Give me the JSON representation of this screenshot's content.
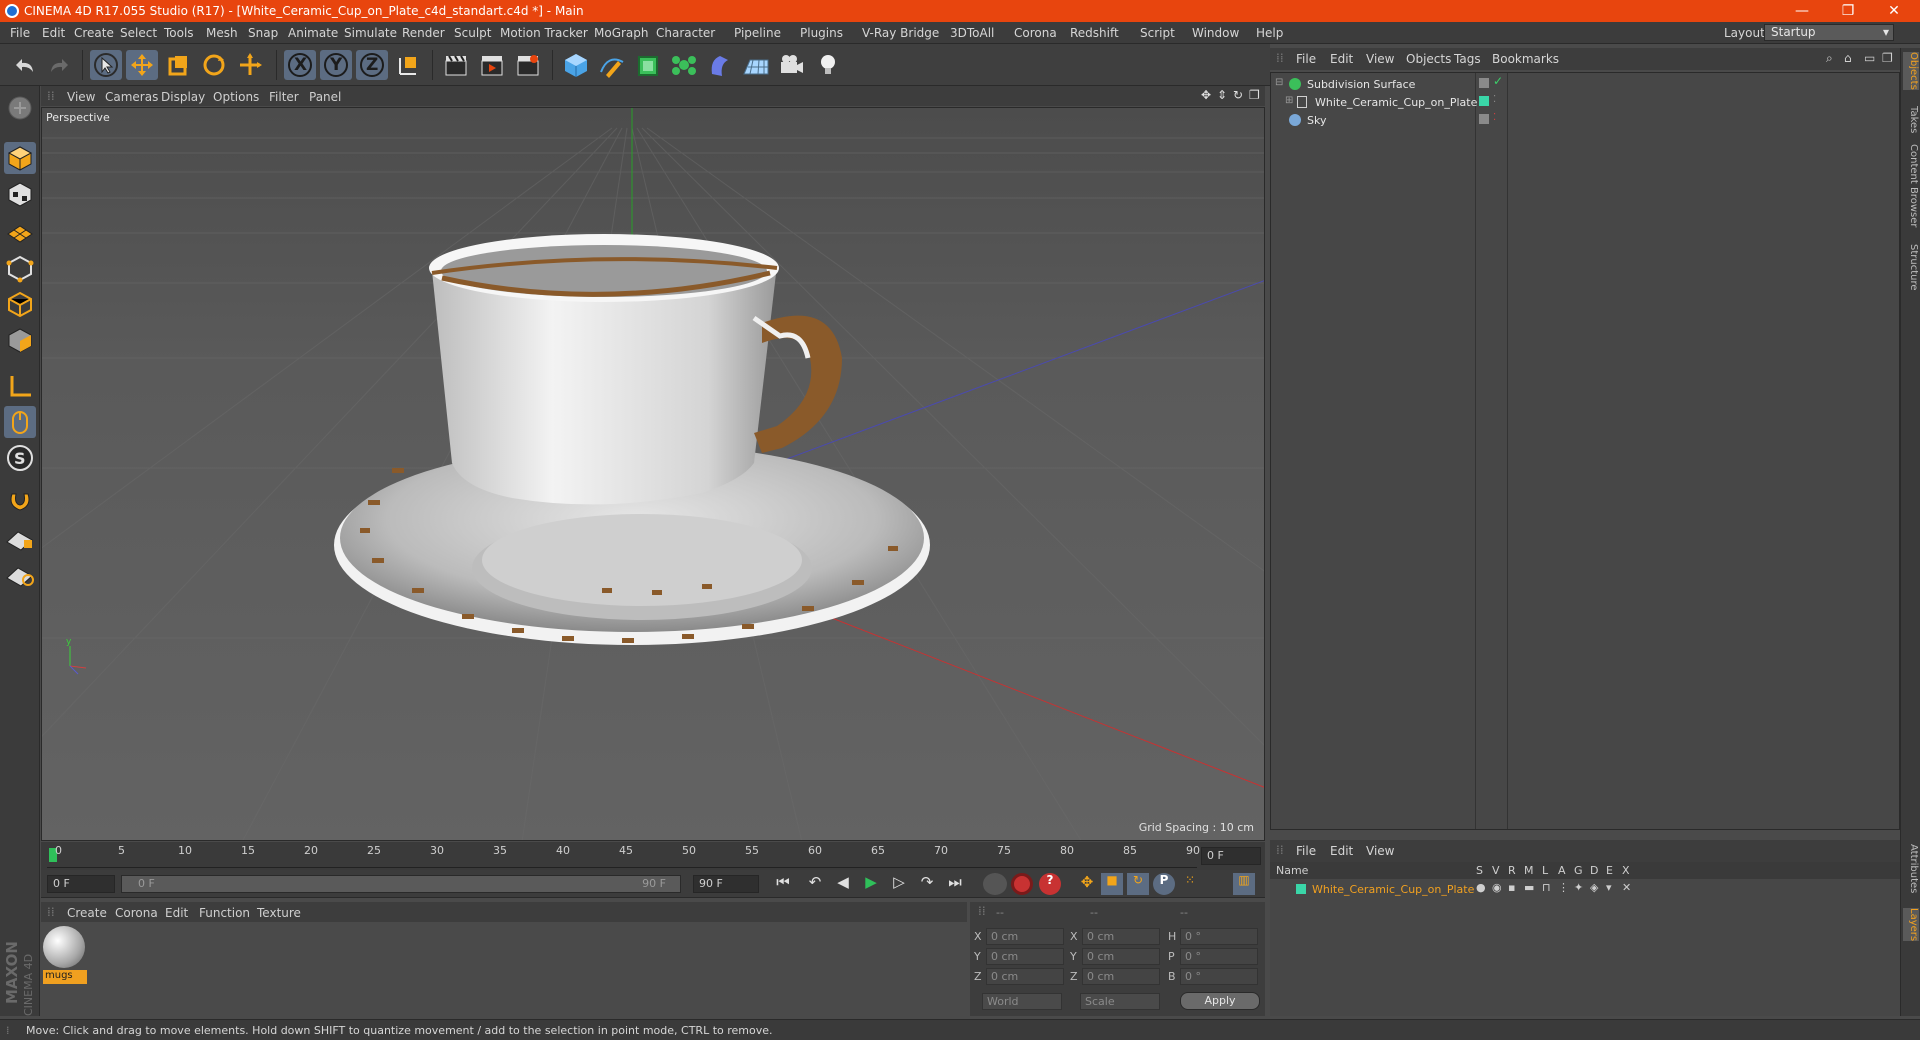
{
  "window": {
    "title": "CINEMA 4D R17.055 Studio (R17) - [White_Ceramic_Cup_on_Plate_c4d_standart.c4d *] - Main",
    "controls": [
      "—",
      "❐",
      "✕"
    ]
  },
  "menubar": {
    "items": [
      "File",
      "Edit",
      "Create",
      "Select",
      "Tools",
      "Mesh",
      "Snap",
      "Animate",
      "Simulate",
      "Render",
      "Sculpt",
      "Motion Tracker",
      "MoGraph",
      "Character",
      "Pipeline",
      "Plugins",
      "V-Ray Bridge",
      "3DToAll",
      "Corona",
      "Redshift",
      "Script",
      "Window",
      "Help"
    ],
    "layout_label": "Layout:",
    "layout_value": "Startup"
  },
  "toolbar": {
    "axis_labels": [
      "X",
      "Y",
      "Z"
    ]
  },
  "viewport": {
    "menu": [
      "View",
      "Cameras",
      "Display",
      "Options",
      "Filter",
      "Panel"
    ],
    "label": "Perspective",
    "grid_spacing": "Grid Spacing : 10 cm"
  },
  "timeline": {
    "ticks": [
      "0",
      "5",
      "10",
      "15",
      "20",
      "25",
      "30",
      "35",
      "40",
      "45",
      "50",
      "55",
      "60",
      "65",
      "70",
      "75",
      "80",
      "85",
      "90"
    ],
    "current_frame": "0 F",
    "start_field": "0 F",
    "range_start": "0 F",
    "range_end": "90 F",
    "end_field": "90 F"
  },
  "materials": {
    "menu": [
      "Create",
      "Corona",
      "Edit",
      "Function",
      "Texture"
    ],
    "items": [
      {
        "name": "mugs"
      }
    ]
  },
  "coordinates": {
    "headers": [
      "--",
      "--",
      "--"
    ],
    "rows": [
      {
        "a": "X",
        "av": "0 cm",
        "b": "X",
        "bv": "0 cm",
        "c": "H",
        "cv": "0 °"
      },
      {
        "a": "Y",
        "av": "0 cm",
        "b": "Y",
        "bv": "0 cm",
        "c": "P",
        "cv": "0 °"
      },
      {
        "a": "Z",
        "av": "0 cm",
        "b": "Z",
        "bv": "0 cm",
        "c": "B",
        "cv": "0 °"
      }
    ],
    "mode_world": "World",
    "mode_scale": "Scale",
    "apply": "Apply"
  },
  "objects": {
    "menu": [
      "File",
      "Edit",
      "View",
      "Objects",
      "Tags",
      "Bookmarks"
    ],
    "rows": [
      {
        "name": "Subdivision Surface"
      },
      {
        "name": "White_Ceramic_Cup_on_Plate"
      },
      {
        "name": "Sky"
      }
    ]
  },
  "layers": {
    "menu": [
      "File",
      "Edit",
      "View"
    ],
    "col_name": "Name",
    "cols": [
      "S",
      "V",
      "R",
      "M",
      "L",
      "A",
      "G",
      "D",
      "E",
      "X"
    ],
    "rows": [
      {
        "name": "White_Ceramic_Cup_on_Plate",
        "color": "#3ad6a8"
      }
    ]
  },
  "sidetabs": [
    "Objects",
    "Takes",
    "Content Browser",
    "Structure",
    "Attributes",
    "Layers"
  ],
  "status": {
    "text": "Move: Click and drag to move elements. Hold down SHIFT to quantize movement / add to the selection in point mode, CTRL to remove."
  },
  "brand": {
    "line1": "MAXON",
    "line2": "CINEMA 4D"
  },
  "colors": {
    "accent": "#e8450e",
    "active_tool": "#5c6c82",
    "selected_text": "#f0a020"
  }
}
